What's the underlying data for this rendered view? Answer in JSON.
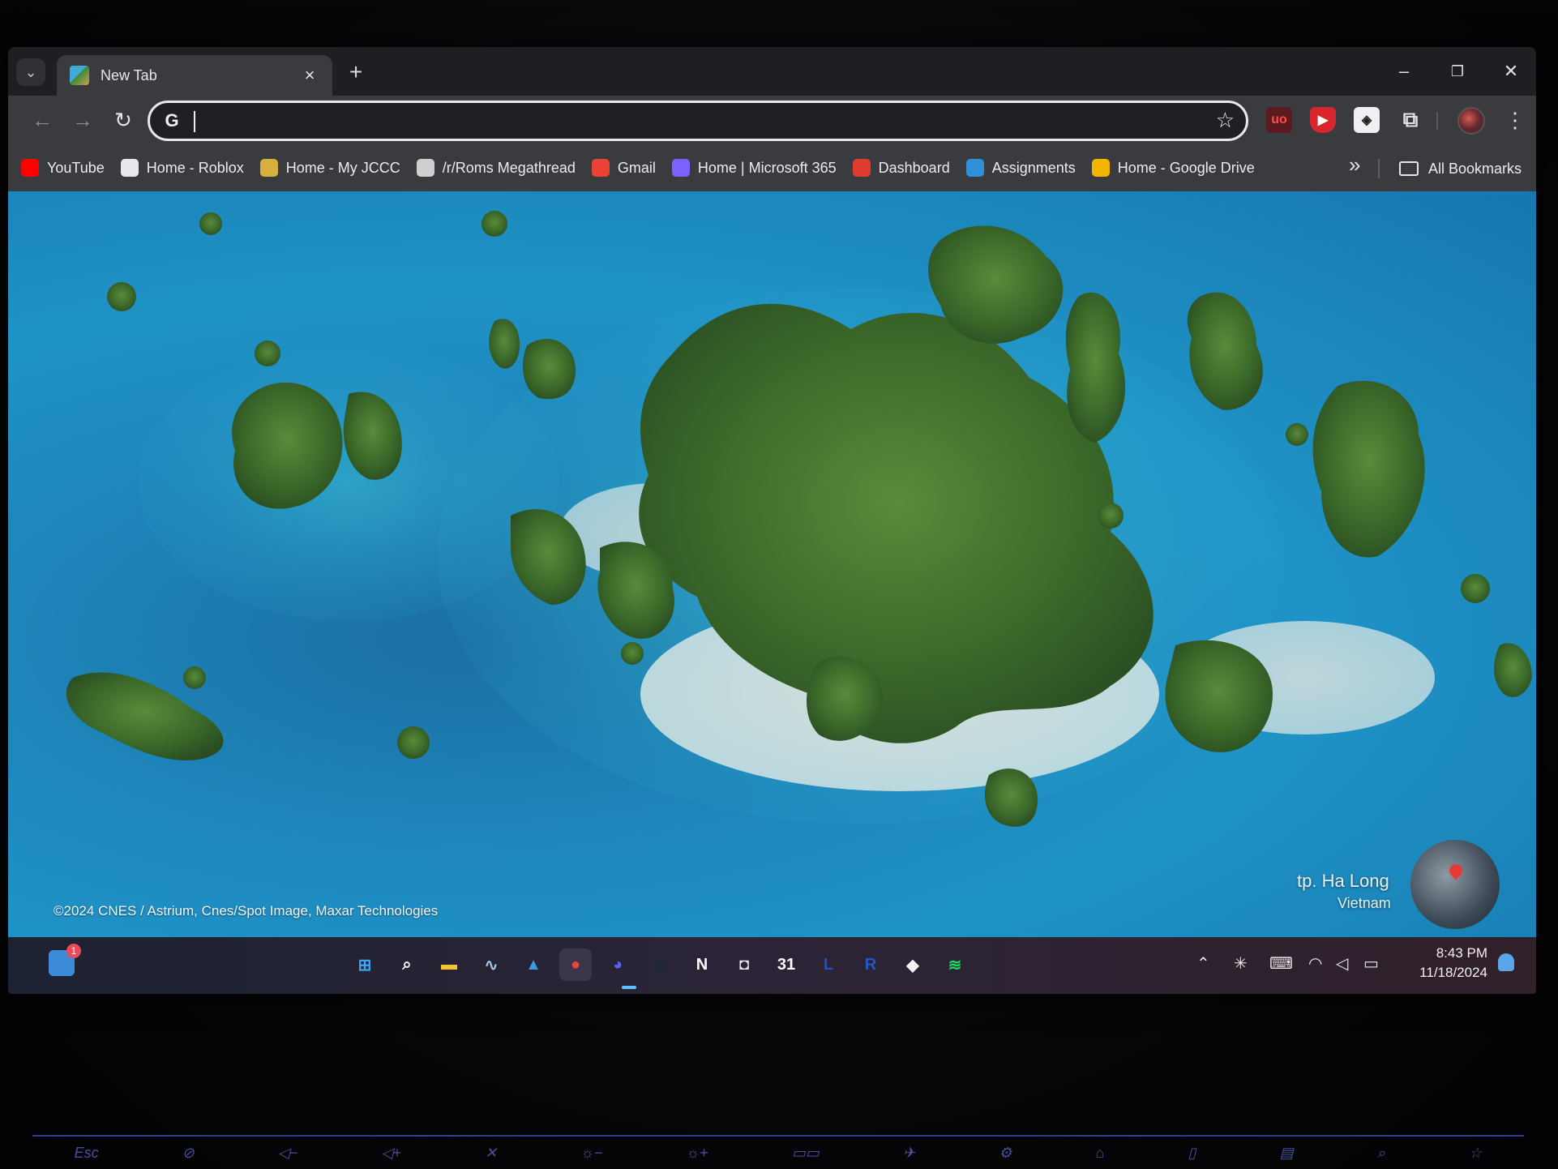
{
  "browser": {
    "tab": {
      "title": "New Tab"
    },
    "omnibox": {
      "value": "",
      "placeholder": ""
    },
    "bookmarks": [
      {
        "label": "YouTube",
        "icon": "youtube-icon",
        "color": "#ff0000"
      },
      {
        "label": "Home - Roblox",
        "icon": "roblox-icon",
        "color": "#e8e8e8"
      },
      {
        "label": "Home - My JCCC",
        "icon": "jccc-icon",
        "color": "#d8b040"
      },
      {
        "label": "/r/Roms Megathread",
        "icon": "page-icon",
        "color": "#cfcfcf"
      },
      {
        "label": "Gmail",
        "icon": "gmail-icon",
        "color": "#ea4335"
      },
      {
        "label": "Home | Microsoft 365",
        "icon": "m365-icon",
        "color": "#7b61ff"
      },
      {
        "label": "Dashboard",
        "icon": "canvas-icon",
        "color": "#e03b2f"
      },
      {
        "label": "Assignments",
        "icon": "p-icon",
        "color": "#2f8fd8"
      },
      {
        "label": "Home - Google Drive",
        "icon": "drive-icon",
        "color": "#f4b400"
      }
    ],
    "all_bookmarks_label": "All Bookmarks"
  },
  "wallpaper": {
    "credit": "©2024 CNES / Astrium, Cnes/Spot Image, Maxar Technologies",
    "location": "tp. Ha Long",
    "country": "Vietnam"
  },
  "taskbar": {
    "widgets_badge": "1",
    "apps": [
      {
        "name": "start-button",
        "glyph": "⊞",
        "color": "#3fa6f5"
      },
      {
        "name": "search-button",
        "glyph": "⌕",
        "color": "#ffffff"
      },
      {
        "name": "file-explorer-app",
        "glyph": "▬",
        "color": "#f3c338"
      },
      {
        "name": "task-manager-app",
        "glyph": "∿",
        "color": "#9fc7e8"
      },
      {
        "name": "photos-app",
        "glyph": "▲",
        "color": "#3a9be0"
      },
      {
        "name": "chrome-app",
        "glyph": "●",
        "color": "#e8453c"
      },
      {
        "name": "discord-app",
        "glyph": "◕",
        "color": "#5865f2"
      },
      {
        "name": "steam-app",
        "glyph": "◉",
        "color": "#1b2838"
      },
      {
        "name": "notion-app",
        "glyph": "N",
        "color": "#ffffff"
      },
      {
        "name": "contacts-app",
        "glyph": "◘",
        "color": "#e6e6e6"
      },
      {
        "name": "calendar-app",
        "glyph": "31",
        "color": "#ffffff"
      },
      {
        "name": "l-app",
        "glyph": "L",
        "color": "#1a4fd8"
      },
      {
        "name": "r-app",
        "glyph": "R",
        "color": "#1f58c8"
      },
      {
        "name": "roblox-app",
        "glyph": "◆",
        "color": "#f2f2f2"
      },
      {
        "name": "spotify-app",
        "glyph": "≋",
        "color": "#1ed760"
      }
    ],
    "clock": {
      "time": "8:43 PM",
      "date": "11/18/2024"
    }
  },
  "keyboard": {
    "keys": [
      "Esc"
    ]
  }
}
